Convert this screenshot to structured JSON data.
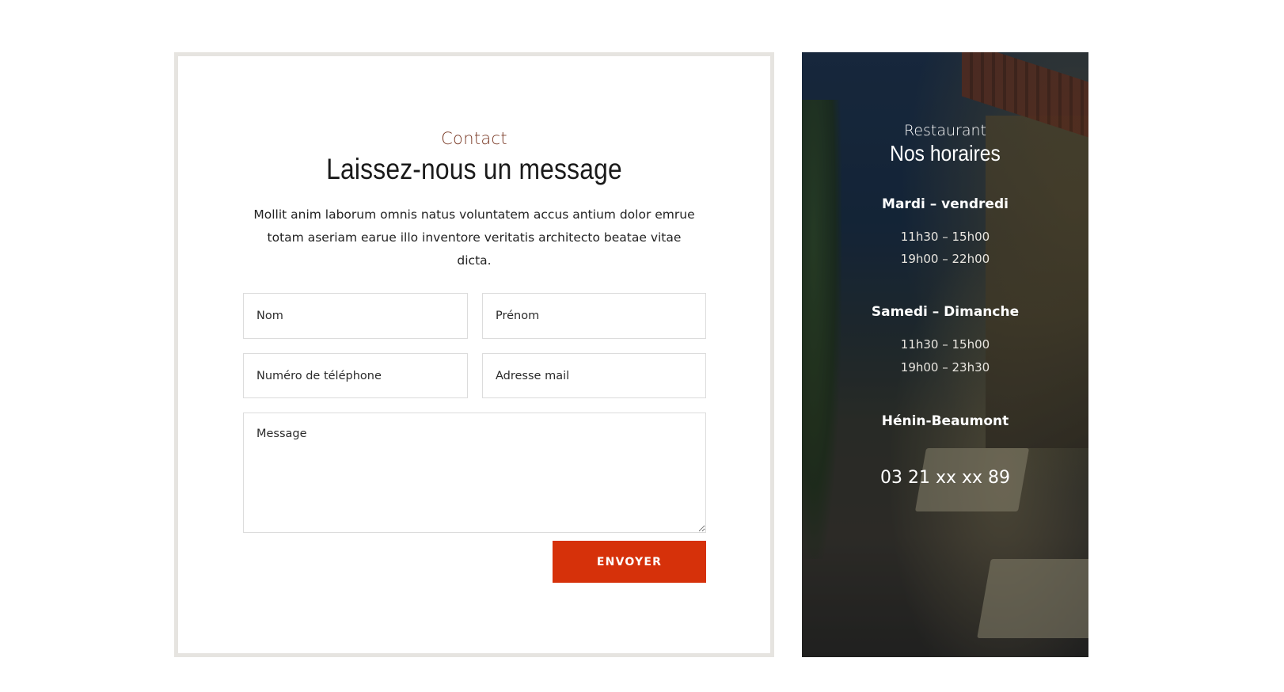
{
  "contact": {
    "eyebrow": "Contact",
    "title": "Laissez-nous un message",
    "intro": "Mollit anim laborum omnis natus voluntatem accus antium dolor emrue totam aseriam earue illo inventore veritatis architecto beatae vitae dicta.",
    "fields": {
      "nom_placeholder": "Nom",
      "prenom_placeholder": "Prénom",
      "telephone_placeholder": "Numéro de téléphone",
      "email_placeholder": "Adresse mail",
      "message_placeholder": "Message"
    },
    "submit_label": "ENVOYER",
    "accent_color": "#d6310a"
  },
  "hours": {
    "eyebrow": "Restaurant",
    "title": "Nos horaires",
    "weekday": {
      "label": "Mardi – vendredi",
      "lunch": "11h30 – 15h00",
      "dinner": "19h00 – 22h00"
    },
    "weekend": {
      "label": "Samedi – Dimanche",
      "lunch": "11h30 – 15h00",
      "dinner": "19h00 – 23h30"
    },
    "city": "Hénin-Beaumont",
    "phone": "03 21 xx xx 89"
  }
}
